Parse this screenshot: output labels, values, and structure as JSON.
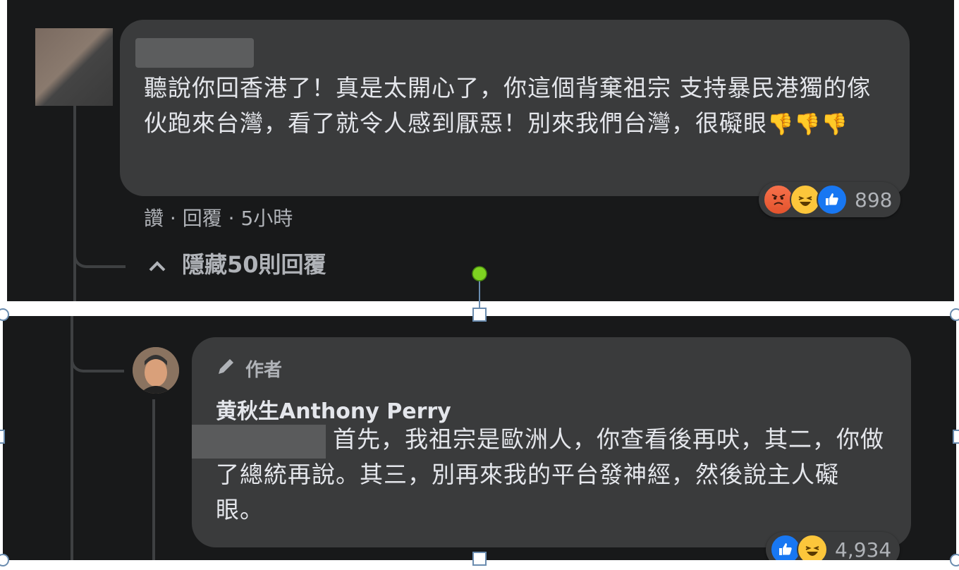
{
  "top_comment": {
    "text": "聽說你回香港了！真是太開心了，你這個背棄祖宗 支持暴民港獨的傢伙跑來台灣，看了就令人感到厭惡！別來我們台灣，很礙眼",
    "emoji": "👎👎👎",
    "reaction_count": "898",
    "reactions": [
      "angry-icon",
      "haha-icon",
      "like-icon"
    ],
    "actions": {
      "like": "讚",
      "reply": "回覆",
      "time": "5小時"
    },
    "hide_replies": "隱藏50則回覆"
  },
  "reply": {
    "author_badge": "作者",
    "author_name": "黄秋生Anthony Perry",
    "text": "首先，我祖宗是歐洲人，你查看後再吠，其二，你做了總統再說。其三，別再來我的平台發神經，然後說主人礙眼。",
    "reaction_count": "4,934",
    "reactions": [
      "like-icon",
      "haha-icon"
    ]
  },
  "colors": {
    "background": "#18191a",
    "bubble": "#3a3b3c",
    "text": "#e4e6eb",
    "secondary_text": "#b0b3b8",
    "like_blue": "#1877f2",
    "handle_green": "#7ed321"
  }
}
